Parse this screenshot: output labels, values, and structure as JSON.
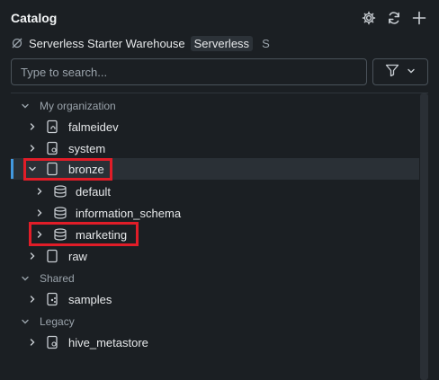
{
  "header": {
    "title": "Catalog"
  },
  "warehouse": {
    "name": "Serverless Starter Warehouse",
    "type": "Serverless",
    "size": "S"
  },
  "search": {
    "placeholder": "Type to search..."
  },
  "tree": {
    "sections": [
      {
        "label": "My organization"
      },
      {
        "label": "Shared"
      },
      {
        "label": "Legacy"
      }
    ],
    "items": [
      {
        "label": "falmeidev"
      },
      {
        "label": "system"
      },
      {
        "label": "bronze"
      },
      {
        "label": "default"
      },
      {
        "label": "information_schema"
      },
      {
        "label": "marketing"
      },
      {
        "label": "raw"
      },
      {
        "label": "samples"
      },
      {
        "label": "hive_metastore"
      }
    ]
  },
  "colors": {
    "accent": "#4299e0",
    "highlight": "#e11d28",
    "background": "#1b1f23"
  }
}
